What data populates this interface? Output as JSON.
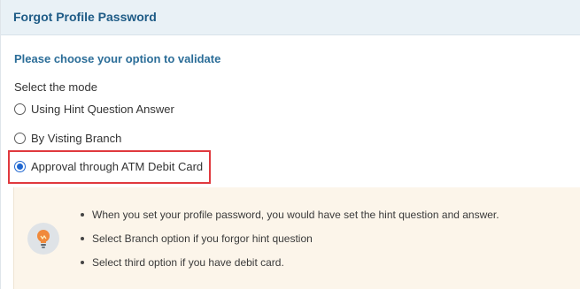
{
  "header": {
    "title": "Forgot Profile Password"
  },
  "form": {
    "subtitle": "Please choose your option to validate",
    "mode_label": "Select the mode",
    "options": [
      {
        "label": "Using Hint Question Answer",
        "selected": false
      },
      {
        "label": "By Visting Branch",
        "selected": false
      },
      {
        "label": "Approval through ATM Debit Card",
        "selected": true
      }
    ]
  },
  "info": {
    "icon": "lightbulb-icon",
    "items": [
      "When you set your profile password, you would have set the hint question and answer.",
      "Select Branch option if you forgor hint question",
      "Select third option if you have debit card."
    ]
  },
  "colors": {
    "accent": "#1e66d0",
    "highlight": "#e0393e",
    "header_bg": "#e9f1f6",
    "info_bg": "#fcf5ea"
  }
}
